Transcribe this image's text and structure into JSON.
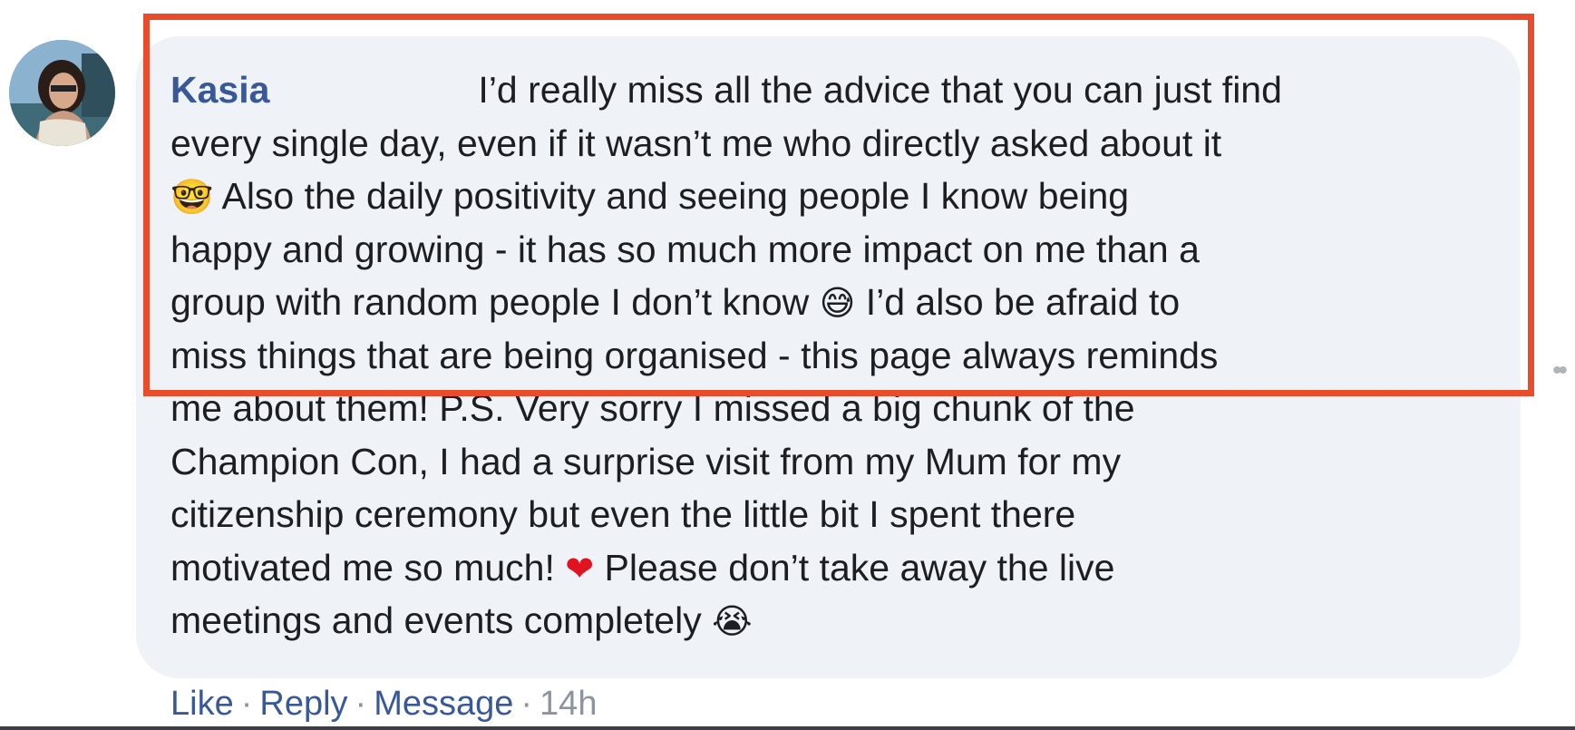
{
  "comment": {
    "author": "Kasia",
    "lines": [
      "I’d really miss all the advice that you can just find",
      "every single day, even if it wasn’t me who directly asked about it",
      "Also the daily positivity and seeing people I know being",
      "happy and growing - it has so much more impact on me than a",
      "group with random people I don’t know",
      "I’d also be afraid to",
      "miss things that are being organised - this page always reminds",
      "me about them! P.S. Very sorry I missed a big chunk of the",
      "Champion Con, I had a surprise visit from my Mum for my",
      "citizenship ceremony but even the little bit I spent there",
      "motivated me so much!",
      "Please don’t take away the live",
      "meetings and events completely"
    ],
    "emojis": {
      "nerd_face": "🤓",
      "grinning_sweat": "😅",
      "heart": "❤",
      "crying": "😭"
    }
  },
  "actions": {
    "like": "Like",
    "reply": "Reply",
    "message": "Message",
    "time": "14h",
    "separator": "·"
  },
  "colors": {
    "author": "#385898",
    "bubble": "#eff2f6",
    "highlight": "#e84c2b",
    "meta": "#8d949e"
  }
}
